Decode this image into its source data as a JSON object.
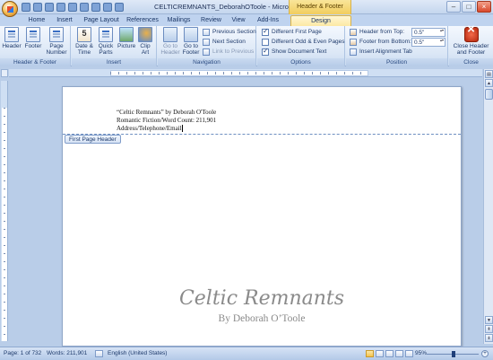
{
  "window": {
    "title": "CELTICREMNANTS_DeborahOToole - Microsoft Word...",
    "contextual_tab_group": "Header & Footer Tools"
  },
  "tabs": [
    "Home",
    "Insert",
    "Page Layout",
    "References",
    "Mailings",
    "Review",
    "View",
    "Add-Ins",
    "Design"
  ],
  "ribbon": {
    "hf_group": {
      "label": "Header & Footer",
      "header": "Header",
      "footer": "Footer",
      "page_number": "Page Number"
    },
    "insert_group": {
      "label": "Insert",
      "date_time": "Date & Time",
      "quick_parts": "Quick Parts",
      "picture": "Picture",
      "clip_art": "Clip Art"
    },
    "navigation_group": {
      "label": "Navigation",
      "goto_header": "Go to Header",
      "goto_footer": "Go to Footer",
      "previous_section": "Previous Section",
      "next_section": "Next Section",
      "link_to_previous": "Link to Previous"
    },
    "options_group": {
      "label": "Options",
      "different_first_page": "Different First Page",
      "different_odd_even": "Different Odd & Even Pages",
      "show_document_text": "Show Document Text",
      "checked": [
        true,
        false,
        true
      ]
    },
    "position_group": {
      "label": "Position",
      "header_from_top": "Header from Top:",
      "header_from_top_value": "0.5\"",
      "footer_from_bottom": "Footer from Bottom:",
      "footer_from_bottom_value": "0.5\"",
      "insert_alignment_tab": "Insert Alignment Tab"
    },
    "close_group": {
      "label": "Close",
      "close_button": "Close Header and Footer"
    }
  },
  "document": {
    "header_lines": [
      "“Celtic Remnants” by Deborah O'Toole",
      "Romantic Fiction/Word Count: 211,901",
      "Address/Telephone/Email"
    ],
    "header_tag": "First Page Header",
    "title": "Celtic Remnants",
    "subtitle": "By Deborah O’Toole"
  },
  "status": {
    "page": "Page: 1 of 732",
    "words": "Words: 211,901",
    "language": "English (United States)",
    "zoom": "95%",
    "zoom_fraction": 0.52
  },
  "colors": {
    "design_tab": "#fce8a4",
    "ribbon": "#dbe7f6",
    "page": "#ffffff",
    "title_text": "#8a8a8a"
  }
}
